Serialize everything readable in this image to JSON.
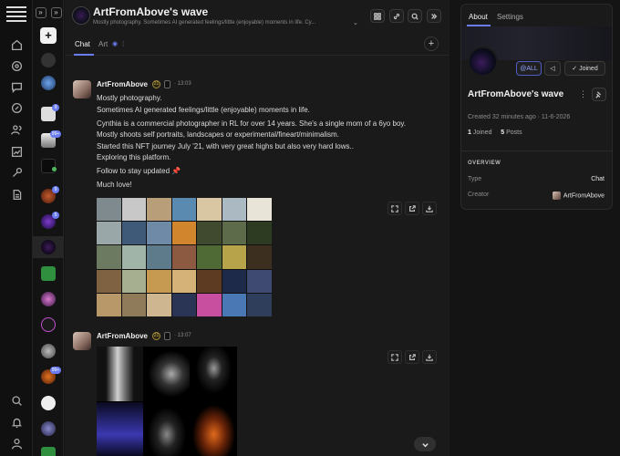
{
  "channel": {
    "title": "ArtFromAbove's wave",
    "subtitle": "Mostly photography. Sometimes AI generated feelings/little (enjoyable) moments in life. Cy..."
  },
  "tabs": {
    "chat": "Chat",
    "art": "Art"
  },
  "messages": [
    {
      "author": "ArtFromAbove",
      "level": "21",
      "time": "13:03",
      "lines": [
        "Mostly photography.",
        "Sometimes AI generated feelings/little (enjoyable) moments in life.",
        "Cynthia is a commercial photographer in RL for over 14 years. She's a single mom of a 6yo boy.",
        "Mostly shoots self portraits, landscapes or experimental/fineart/minimalism.",
        "Started this NFT journey July '21, with very great highs but also very hard lows..",
        "Exploring this platform.",
        "Follow to stay updated 📌",
        "Much love!"
      ]
    },
    {
      "author": "ArtFromAbove",
      "level": "21",
      "time": "13:07"
    }
  ],
  "space_badges": [
    "9",
    "99+",
    "9",
    "5",
    "99+"
  ],
  "panel": {
    "tab_about": "About",
    "tab_settings": "Settings",
    "all_label": "@ALL",
    "joined_label": "Joined",
    "name": "ArtFromAbove's wave",
    "created": "Created 32 minutes ago · 11-6-2026",
    "joined_count": "1",
    "joined_text": "Joined",
    "posts_count": "5",
    "posts_text": "Posts",
    "overview_title": "OVERVIEW",
    "type_label": "Type",
    "type_value": "Chat",
    "creator_label": "Creator",
    "creator_value": "ArtFromAbove"
  },
  "colors": {
    "accent": "#6a7cf0",
    "background": "#1a1a1a"
  }
}
